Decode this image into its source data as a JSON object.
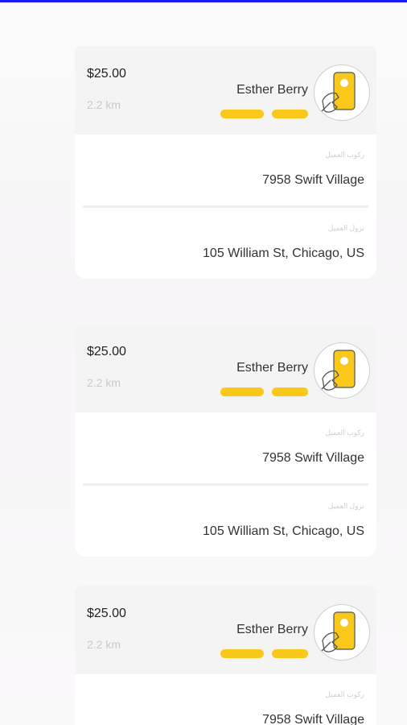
{
  "orders": [
    {
      "price": "$25.00",
      "distance": "2.2 km",
      "customer_name": "Esther Berry",
      "tags": [
        "",
        ""
      ],
      "pickup_label": "ركوب العميل",
      "pickup_address": "7958 Swift Village",
      "dropoff_label": "نزول العميل",
      "dropoff_address": "105 William St, Chicago, US",
      "avatar_icon": "phone-in-hand-icon"
    },
    {
      "price": "$25.00",
      "distance": "2.2 km",
      "customer_name": "Esther Berry",
      "tags": [
        "",
        ""
      ],
      "pickup_label": "ركوب العميل",
      "pickup_address": "7958 Swift Village",
      "dropoff_label": "نزول العميل",
      "dropoff_address": "105 William St, Chicago, US",
      "avatar_icon": "phone-in-hand-icon"
    },
    {
      "price": "$25.00",
      "distance": "2.2 km",
      "customer_name": "Esther Berry",
      "tags": [
        "",
        ""
      ],
      "pickup_label": "ركوب العميل",
      "pickup_address": "7958 Swift Village",
      "avatar_icon": "phone-in-hand-icon"
    }
  ],
  "colors": {
    "accent": "#f9c81b",
    "top_bar": "#1a1aff",
    "card_header": "#f4f4f4"
  }
}
